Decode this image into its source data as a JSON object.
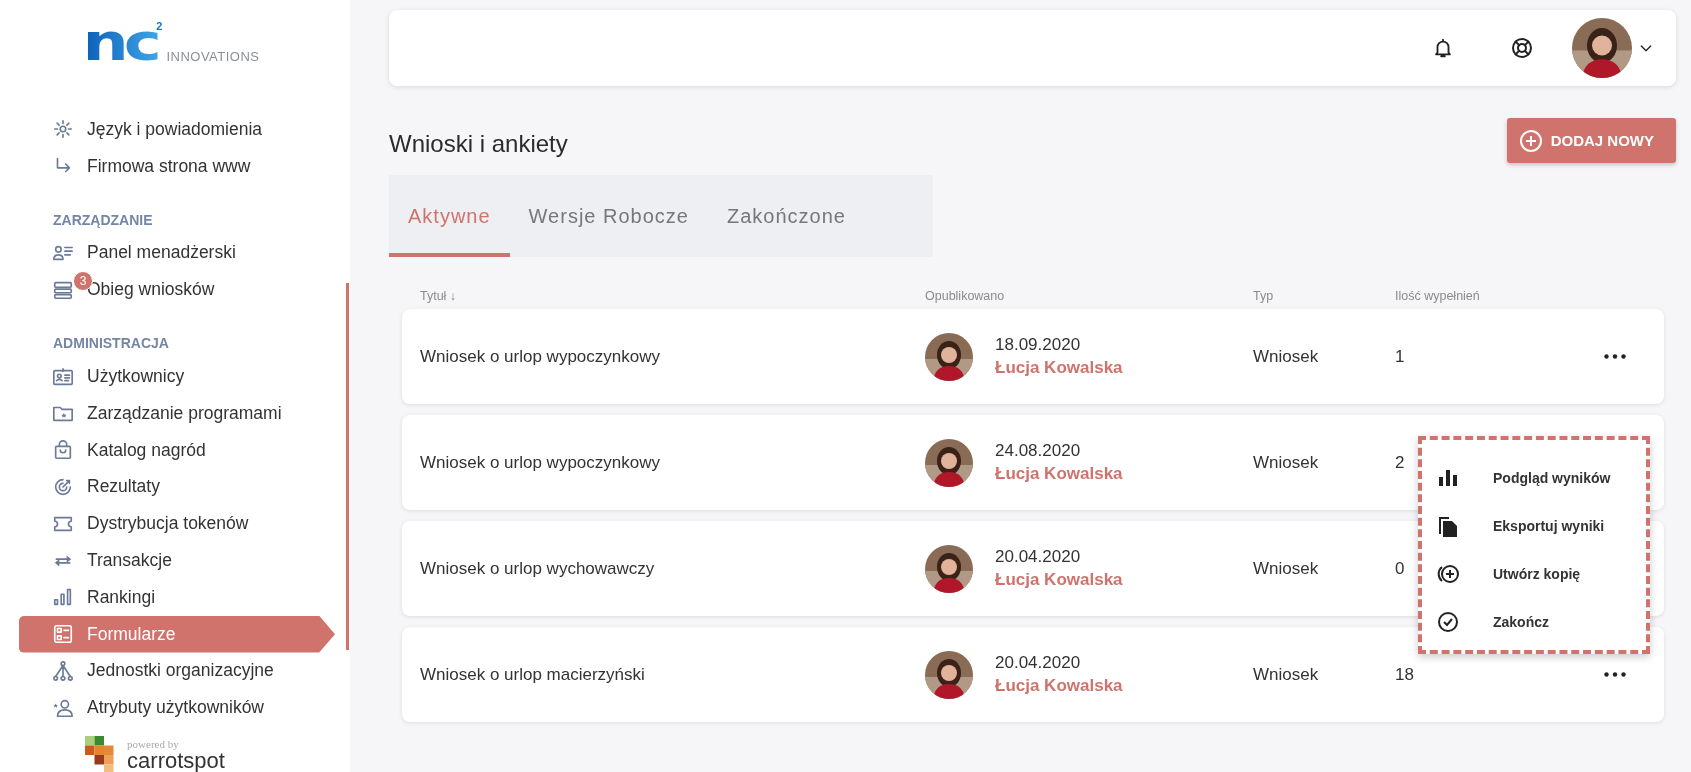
{
  "logo": {
    "mark": "nc",
    "superscript": "2",
    "text": "INNOVATIONS"
  },
  "sidebar": {
    "groups": [
      {
        "items": [
          {
            "label": "Język i powiadomienia",
            "selected": false
          },
          {
            "label": "Firmowa strona www",
            "selected": false
          }
        ]
      },
      {
        "heading": "ZARZĄDZANIE",
        "items": [
          {
            "label": "Panel menadżerski",
            "selected": false
          },
          {
            "label": "Obieg wniosków",
            "selected": false,
            "badge": "3"
          }
        ]
      },
      {
        "heading": "ADMINISTRACJA",
        "items": [
          {
            "label": "Użytkownicy",
            "selected": false
          },
          {
            "label": "Zarządzanie programami",
            "selected": false
          },
          {
            "label": "Katalog nagród",
            "selected": false
          },
          {
            "label": "Rezultaty",
            "selected": false
          },
          {
            "label": "Dystrybucja tokenów",
            "selected": false
          },
          {
            "label": "Transakcje",
            "selected": false
          },
          {
            "label": "Rankingi",
            "selected": false
          },
          {
            "label": "Formularze",
            "selected": true
          },
          {
            "label": "Jednostki organizacyjne",
            "selected": false
          },
          {
            "label": "Atrybuty użytkowników",
            "selected": false
          }
        ]
      }
    ],
    "powered_by": {
      "caption": "powered by",
      "name": "carrotspot"
    }
  },
  "page": {
    "title": "Wnioski i ankiety",
    "add_button": "DODAJ NOWY"
  },
  "tabs": [
    {
      "label": "Aktywne",
      "selected": true
    },
    {
      "label": "Wersje Robocze",
      "selected": false
    },
    {
      "label": "Zakończone",
      "selected": false
    }
  ],
  "table": {
    "columns": [
      {
        "label": "Tytuł",
        "sort": "↓"
      },
      {
        "label": "Opublikowano"
      },
      {
        "label": "Typ"
      },
      {
        "label": "Ilość wypełnień"
      }
    ],
    "rows": [
      {
        "title": "Wniosek o urlop wypoczynkowy",
        "date": "18.09.2020",
        "author": "Łucja Kowalska",
        "type": "Wniosek",
        "count": "1",
        "actions_visible": true
      },
      {
        "title": "Wniosek o urlop wypoczynkowy",
        "date": "24.08.2020",
        "author": "Łucja Kowalska",
        "type": "Wniosek",
        "count": "2",
        "actions_visible": false
      },
      {
        "title": "Wniosek o urlop wychowawczy",
        "date": "20.04.2020",
        "author": "Łucja Kowalska",
        "type": "Wniosek",
        "count": "0",
        "actions_visible": false
      },
      {
        "title": "Wniosek o urlop macierzyński",
        "date": "20.04.2020",
        "author": "Łucja Kowalska",
        "type": "Wniosek",
        "count": "18",
        "actions_visible": true
      }
    ],
    "row_menu": {
      "items": [
        "Podgląd wyników",
        "Eksportuj wyniki",
        "Utwórz kopię",
        "Zakończ"
      ]
    }
  }
}
